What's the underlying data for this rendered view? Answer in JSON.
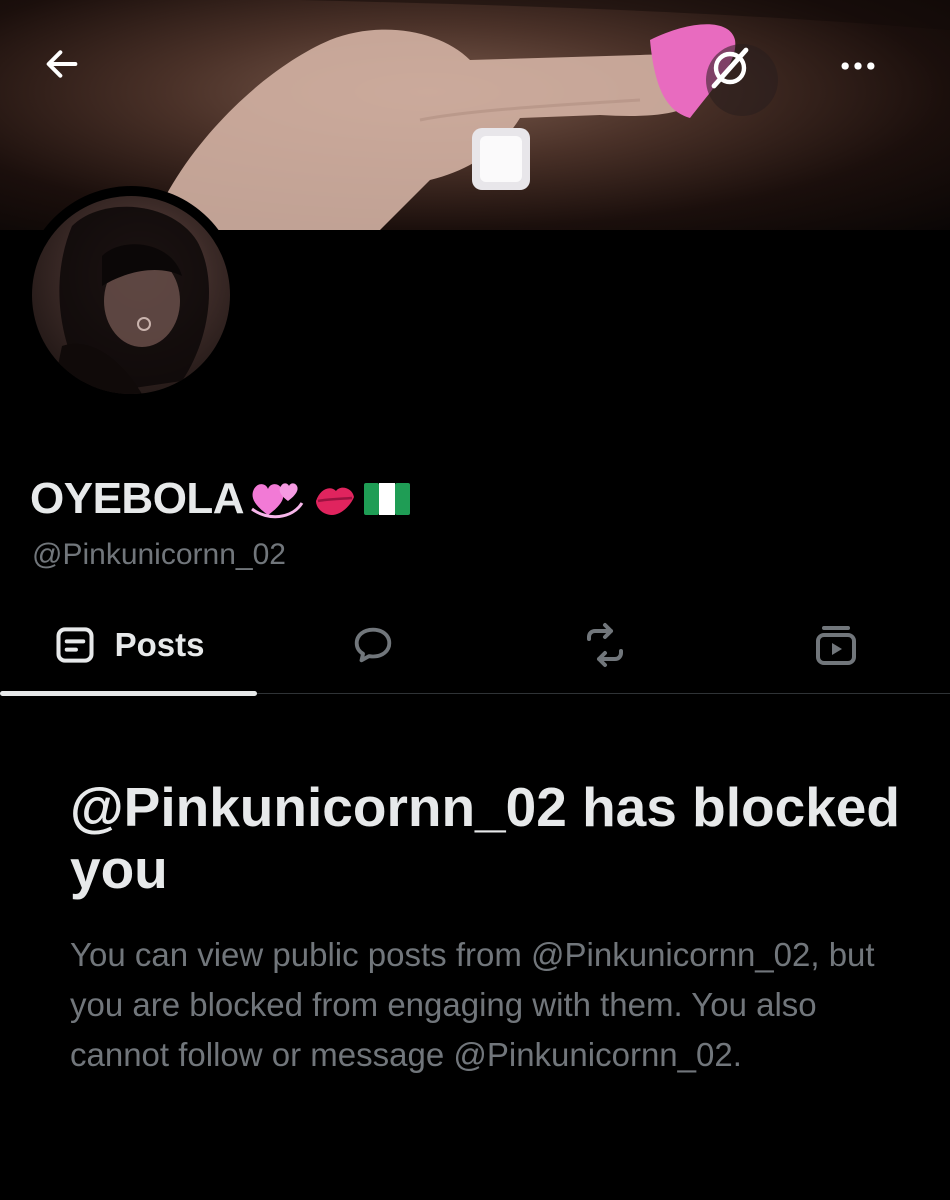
{
  "header": {
    "back_icon": "arrow-left-icon",
    "grok_icon": "grok-icon",
    "more_icon": "more-horizontal-icon"
  },
  "profile": {
    "display_name": "OYEBOLA",
    "name_emojis": [
      "revolving-hearts-emoji",
      "kiss-mark-emoji",
      "nigeria-flag-emoji"
    ],
    "handle": "@Pinkunicornn_02"
  },
  "tabs": [
    {
      "label": "Posts",
      "icon": "posts-icon",
      "selected": true
    },
    {
      "label": "",
      "icon": "reply-icon",
      "selected": false
    },
    {
      "label": "",
      "icon": "repost-icon",
      "selected": false
    },
    {
      "label": "",
      "icon": "media-icon",
      "selected": false
    }
  ],
  "blocked": {
    "title": "@Pinkunicornn_02 has blocked you",
    "body": "You can view public posts from @Pinkunicornn_02, but you are blocked from engaging with them. You also cannot follow or message @Pinkunicornn_02."
  },
  "colors": {
    "background": "#000000",
    "primary_text": "#e7e9ea",
    "secondary_text": "#71767b",
    "divider": "#2f3336"
  }
}
